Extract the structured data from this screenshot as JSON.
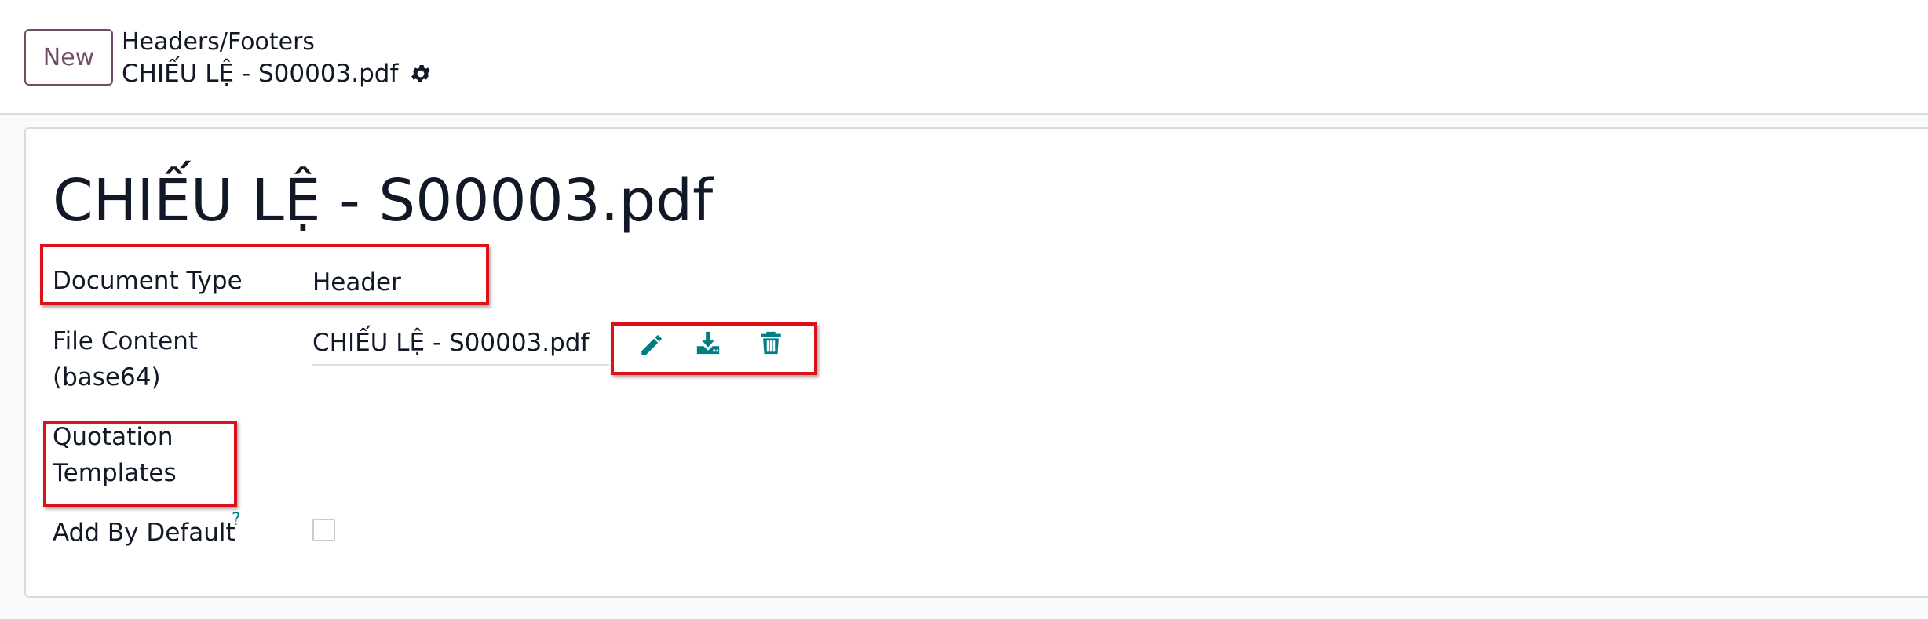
{
  "control_panel": {
    "new_label": "New",
    "breadcrumb_parent": "Headers/Footers",
    "breadcrumb_current": "CHIẾU LỆ - S00003.pdf"
  },
  "form": {
    "title": "CHIẾU LỆ - S00003.pdf",
    "document_type": {
      "label": "Document Type",
      "value": "Header"
    },
    "file_content": {
      "label_line1": "File Content",
      "label_line2": "(base64)",
      "value": "CHIẾU LỆ - S00003.pdf",
      "actions": [
        "pencil-icon",
        "download-icon",
        "trash-icon"
      ]
    },
    "quotation_templates": {
      "label_line1": "Quotation",
      "label_line2": "Templates"
    },
    "add_by_default": {
      "label": "Add By Default",
      "help": "?",
      "checked": false
    }
  },
  "colors": {
    "brand": "#714b67",
    "action_icon": "#017e84",
    "annotation": "#e0101b"
  }
}
